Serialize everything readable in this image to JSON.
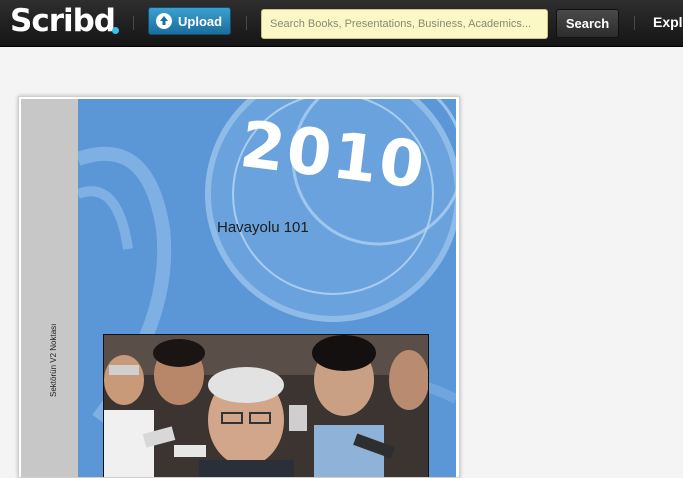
{
  "header": {
    "logo_text": "Scribd",
    "upload_label": "Upload",
    "search_placeholder": "Search Books, Presentations, Business, Academics...",
    "search_button": "Search",
    "explore_label": "Explore"
  },
  "document": {
    "spine_text": "Sektörün V2 Noktası",
    "cover_year": "2010",
    "cover_title": "Havayolu 101"
  },
  "colors": {
    "topbar": "#1e1e1e",
    "upload_button": "#2a86b8",
    "search_field": "#fbf8c6",
    "cover_blue": "#5b96d6"
  },
  "icons": {
    "upload": "upload-arrow-icon"
  }
}
